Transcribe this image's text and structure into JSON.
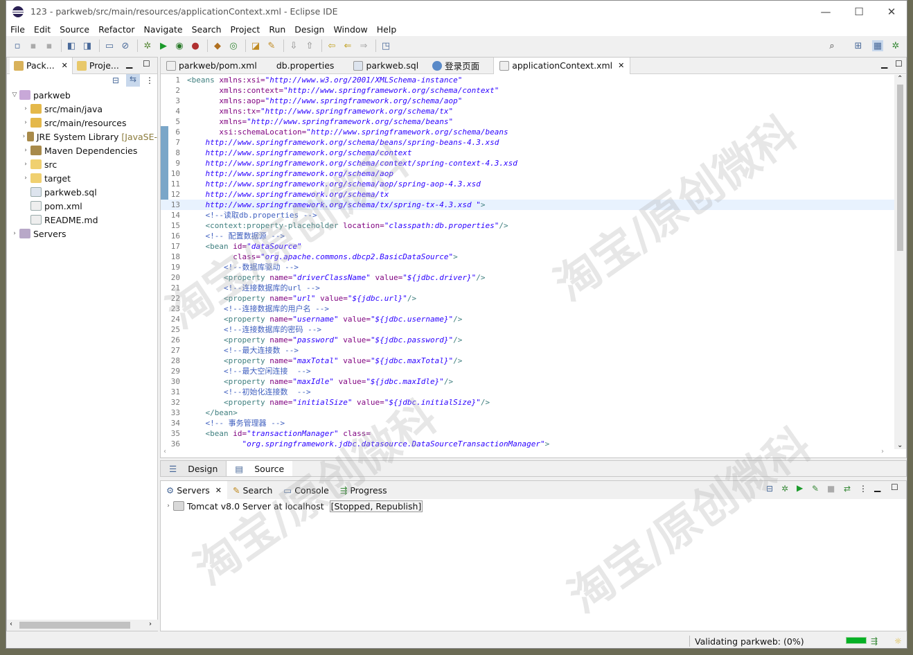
{
  "window": {
    "title": "123 - parkweb/src/main/resources/applicationContext.xml - Eclipse IDE",
    "minimize": "—",
    "maximize": "☐",
    "close": "✕"
  },
  "menu": [
    "File",
    "Edit",
    "Source",
    "Refactor",
    "Navigate",
    "Search",
    "Project",
    "Run",
    "Design",
    "Window",
    "Help"
  ],
  "left_tabs": [
    {
      "label": "Pack..."
    },
    {
      "label": "Proje..."
    }
  ],
  "tree": [
    {
      "label": "parkweb",
      "extra": ""
    },
    {
      "label": "src/main/java",
      "extra": ""
    },
    {
      "label": "src/main/resources",
      "extra": ""
    },
    {
      "label": "JRE System Library",
      "extra": "[JavaSE-"
    },
    {
      "label": "Maven Dependencies",
      "extra": ""
    },
    {
      "label": "src",
      "extra": ""
    },
    {
      "label": "target",
      "extra": ""
    },
    {
      "label": "parkweb.sql",
      "extra": ""
    },
    {
      "label": "pom.xml",
      "extra": ""
    },
    {
      "label": "README.md",
      "extra": ""
    },
    {
      "label": "Servers",
      "extra": ""
    }
  ],
  "editor_tabs": [
    "parkweb/pom.xml",
    "db.properties",
    "parkweb.sql",
    "登录页面",
    "applicationContext.xml"
  ],
  "code_lines": [
    "1",
    "2",
    "3",
    "4",
    "5",
    "6",
    "7",
    "8",
    "9",
    "10",
    "11",
    "12",
    "13",
    "14",
    "15",
    "16",
    "17",
    "18",
    "19",
    "20",
    "21",
    "22",
    "23",
    "24",
    "25",
    "26",
    "27",
    "28",
    "29",
    "30",
    "31",
    "32",
    "33",
    "34",
    "35",
    "36"
  ],
  "code": {
    "l1a": "<beans",
    "l1b": " xmlns:xsi=",
    "l1c": "\"http://www.w3.org/2001/XMLSchema-instance\"",
    "l2b": "xmlns:context=",
    "l2c": "\"http://www.springframework.org/schema/context\"",
    "l3b": "xmlns:aop=",
    "l3c": "\"http://www.springframework.org/schema/aop\"",
    "l4b": "xmlns:tx=",
    "l4c": "\"http://www.springframework.org/schema/tx\"",
    "l5b": "xmlns=",
    "l5c": "\"http://www.springframework.org/schema/beans\"",
    "l6b": "xsi:schemaLocation=",
    "l6c": "\"http://www.springframework.org/schema/beans",
    "l7": "http://www.springframework.org/schema/beans/spring-beans-4.3.xsd",
    "l8": "http://www.springframework.org/schema/context",
    "l9": "http://www.springframework.org/schema/context/spring-context-4.3.xsd",
    "l10": "http://www.springframework.org/schema/aop",
    "l11": "http://www.springframework.org/schema/aop/spring-aop-4.3.xsd",
    "l12": "http://www.springframework.org/schema/tx",
    "l13a": "http://www.springframework.org/schema/tx/spring-tx-4.3.xsd \"",
    "l13b": ">",
    "l14": "<!--读取db.properties -->",
    "l15a": "<context:property-placeholder",
    "l15b": " location=",
    "l15c": "\"classpath:db.properties\"",
    "l15d": "/>",
    "l16": "<!-- 配置数据源 -->",
    "l17a": "<bean",
    "l17b": " id=",
    "l17c": "\"dataSource\"",
    "l18b": "class=",
    "l18c": "\"org.apache.commons.dbcp2.BasicDataSource\"",
    "l18d": ">",
    "l19": "<!--数据库驱动 -->",
    "l20a": "<property",
    "l20b": " name=",
    "l20c": "\"driverClassName\"",
    "l20d": " value=",
    "l20e": "\"${jdbc.driver}\"",
    "l20f": "/>",
    "l21": "<!--连接数据库的url -->",
    "l22a": "<property",
    "l22b": " name=",
    "l22c": "\"url\"",
    "l22d": " value=",
    "l22e": "\"${jdbc.url}\"",
    "l22f": "/>",
    "l23": "<!--连接数据库的用户名 -->",
    "l24a": "<property",
    "l24b": " name=",
    "l24c": "\"username\"",
    "l24d": " value=",
    "l24e": "\"${jdbc.username}\"",
    "l24f": "/>",
    "l25": "<!--连接数据库的密码 -->",
    "l26a": "<property",
    "l26b": " name=",
    "l26c": "\"password\"",
    "l26d": " value=",
    "l26e": "\"${jdbc.password}\"",
    "l26f": "/>",
    "l27": "<!--最大连接数 -->",
    "l28a": "<property",
    "l28b": " name=",
    "l28c": "\"maxTotal\"",
    "l28d": " value=",
    "l28e": "\"${jdbc.maxTotal}\"",
    "l28f": "/>",
    "l29": "<!--最大空闲连接  -->",
    "l30a": "<property",
    "l30b": " name=",
    "l30c": "\"maxIdle\"",
    "l30d": " value=",
    "l30e": "\"${jdbc.maxIdle}\"",
    "l30f": "/>",
    "l31": "<!--初始化连接数  -->",
    "l32a": "<property",
    "l32b": " name=",
    "l32c": "\"initialSize\"",
    "l32d": " value=",
    "l32e": "\"${jdbc.initialSize}\"",
    "l32f": "/>",
    "l33": "</bean>",
    "l34": "<!-- 事务管理器 -->",
    "l35a": "<bean",
    "l35b": " id=",
    "l35c": "\"transactionManager\"",
    "l35d": " class=",
    "l36c": "\"org.springframework.jdbc.datasource.DataSourceTransactionManager\"",
    "l36d": ">"
  },
  "design_tabs": [
    "Design",
    "Source"
  ],
  "bottom_tabs": [
    "Servers",
    "Search",
    "Console",
    "Progress"
  ],
  "servers": [
    {
      "name": "Tomcat v8.0 Server at localhost",
      "state": "[Stopped, Republish]"
    }
  ],
  "status": {
    "text": "Validating parkweb: (0%)"
  },
  "watermark": "淘宝/原创微科",
  "colors": {
    "tag": "#3f7f7f",
    "attr": "#7f007f",
    "value": "#2a00ff",
    "comment": "#3f5fbf",
    "progress": "#06b025"
  }
}
